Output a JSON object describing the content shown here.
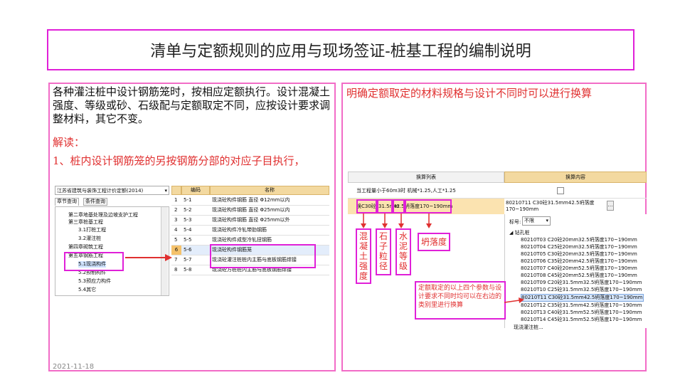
{
  "title": "清单与定额规则的应用与现场签证-桩基工程的编制说明",
  "left": {
    "paragraph": "各种灌注桩中设计钢筋笼时，按相应定额执行。设计混凝土强度、等级或砂、石级配与定额取定不同，应按设计要求调整材料，其它不变。",
    "interpret_label": "解读：",
    "point1": "1、桩内设计钢筋笼的另按钢筋分部的对应子目执行，",
    "date": "2021-11-18",
    "screenshot": {
      "dropdown_value": "江苏省建筑与装饰工程计价定额(2014)",
      "tabs": [
        "章节查询",
        "条件查询"
      ],
      "tree": [
        "第二章地基处理及边坡支护工程",
        "第三章桩基工程",
        "3.1打桩工程",
        "3.2灌注桩",
        "第四章砌筑工程",
        "第五章钢筋工程",
        "5.1现浇构件",
        "5.2预制构件",
        "5.3预应力构件",
        "5.4其它"
      ],
      "headers": [
        "编码",
        "名称"
      ],
      "rows": [
        {
          "n": "1",
          "code": "5-1",
          "name": "现浇砼构件钢筋 直径 Φ12mm以内"
        },
        {
          "n": "2",
          "code": "5-2",
          "name": "现浇砼构件钢筋 直径 Φ25mm以内"
        },
        {
          "n": "3",
          "code": "5-3",
          "name": "现浇砼构件钢筋 直径 Φ25mm以外"
        },
        {
          "n": "4",
          "code": "5-4",
          "name": "现浇砼构件冷轧带肋钢筋"
        },
        {
          "n": "5",
          "code": "5-5",
          "name": "现浇砼构件成型冷轧扭钢筋"
        },
        {
          "n": "6",
          "code": "5-6",
          "name": "现浇砼构件钢筋笼"
        },
        {
          "n": "7",
          "code": "5-7",
          "name": "现浇砼灌注桩桩内主筋与底板钢筋焊接"
        },
        {
          "n": "8",
          "code": "5-8",
          "name": "现浇砼方桩桩内主筋与底板钢筋焊接"
        }
      ]
    }
  },
  "right": {
    "paragraph": "明确定额取定的材料规格与设计不同时可以进行换算",
    "screenshot": {
      "header_left": "换算列表",
      "header_right": "换算内容",
      "row1": "当工程量小于60m3时 机械*1.25,人工*1.25",
      "row2_parts": [
        "换C30砼",
        "31.5mm",
        "42.5",
        "坍落度170~190mm"
      ],
      "content_value": "80210711  C30砼31.5mm42.5坍落度170~190mm",
      "label_field": "标号:",
      "label_value": "不限",
      "tree_root": "钻孔桩",
      "tree_items": [
        "80210T03  C20砼20mm32.5坍落度170~190mm",
        "80210T04  C25砼20mm32.5坍落度170~190mm",
        "80210T05  C30砼20mm32.5坍落度170~190mm",
        "80210T06  C35砼20mm42.5坍落度170~190mm",
        "80210T07  C40砼20mm52.5坍落度170~190mm",
        "80210T08  C45砼20mm52.5坍落度170~190mm",
        "80210T09  C20砼31.5mm32.5坍落度170~190mm",
        "80210T10  C25砼31.5mm32.5坍落度170~190mm",
        "80210T11  C30砼31.5mm42.5坍落度170~190mm",
        "80210T12  C35砼31.5mm42.5坍落度170~190mm",
        "80210T13  C40砼31.5mm52.5坍落度170~190mm",
        "80210T14  C45砼31.5mm52.5坍落度170~190mm"
      ],
      "tree_last": "现浇灌注桩..."
    },
    "labels": {
      "concrete_strength": "混凝土强度",
      "stone_size": "石子粒径",
      "cement_grade": "水泥等级",
      "slump": "坍落度"
    },
    "note": "定额取定的以上四个参数与设计要求不同时均可以在右边的类别里进行换算"
  },
  "colors": {
    "magenta": "#e020d8",
    "red": "#e03030",
    "pink": "#f26cc7",
    "header": "#f3d9a0"
  }
}
